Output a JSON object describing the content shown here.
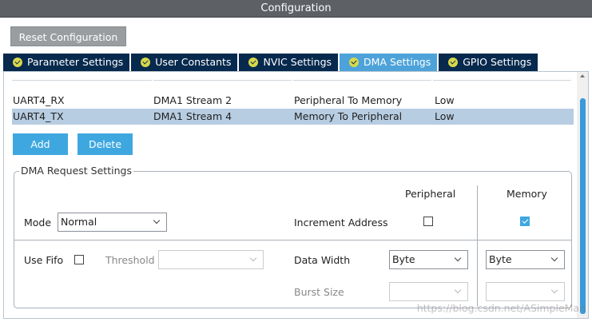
{
  "window": {
    "title": "Configuration"
  },
  "toolbar": {
    "reset_label": "Reset Configuration"
  },
  "tabs": [
    {
      "label": "Parameter Settings",
      "icon": "check-circle-icon",
      "active": false
    },
    {
      "label": "User Constants",
      "icon": "check-circle-icon",
      "active": false
    },
    {
      "label": "NVIC Settings",
      "icon": "check-circle-icon",
      "active": false
    },
    {
      "label": "DMA Settings",
      "icon": "check-circle-icon",
      "active": true
    },
    {
      "label": "GPIO Settings",
      "icon": "check-circle-icon",
      "active": false
    }
  ],
  "dma_table": {
    "rows": [
      {
        "request": "UART4_RX",
        "stream": "DMA1 Stream 2",
        "direction": "Peripheral To Memory",
        "priority": "Low",
        "selected": false
      },
      {
        "request": "UART4_TX",
        "stream": "DMA1 Stream 4",
        "direction": "Memory To Peripheral",
        "priority": "Low",
        "selected": true
      }
    ]
  },
  "actions": {
    "add_label": "Add",
    "delete_label": "Delete"
  },
  "request_settings": {
    "title": "DMA Request Settings",
    "peripheral_header": "Peripheral",
    "memory_header": "Memory",
    "mode_label": "Mode",
    "mode_value": "Normal",
    "increment_address_label": "Increment Address",
    "increment_peripheral": false,
    "increment_memory": true,
    "use_fifo_label": "Use Fifo",
    "use_fifo": false,
    "threshold_label": "Threshold",
    "threshold_value": "",
    "data_width_label": "Data Width",
    "data_width_peripheral": "Byte",
    "data_width_memory": "Byte",
    "burst_size_label": "Burst Size",
    "burst_size_peripheral": "",
    "burst_size_memory": ""
  },
  "watermark": "https://blog.csdn.net/ASimpleMan",
  "colors": {
    "titlebar": "#5d6166",
    "tab_bg": "#06294d",
    "tab_active": "#4da3d9",
    "accent": "#3ea7e0",
    "selected_row": "#b7cde2"
  }
}
